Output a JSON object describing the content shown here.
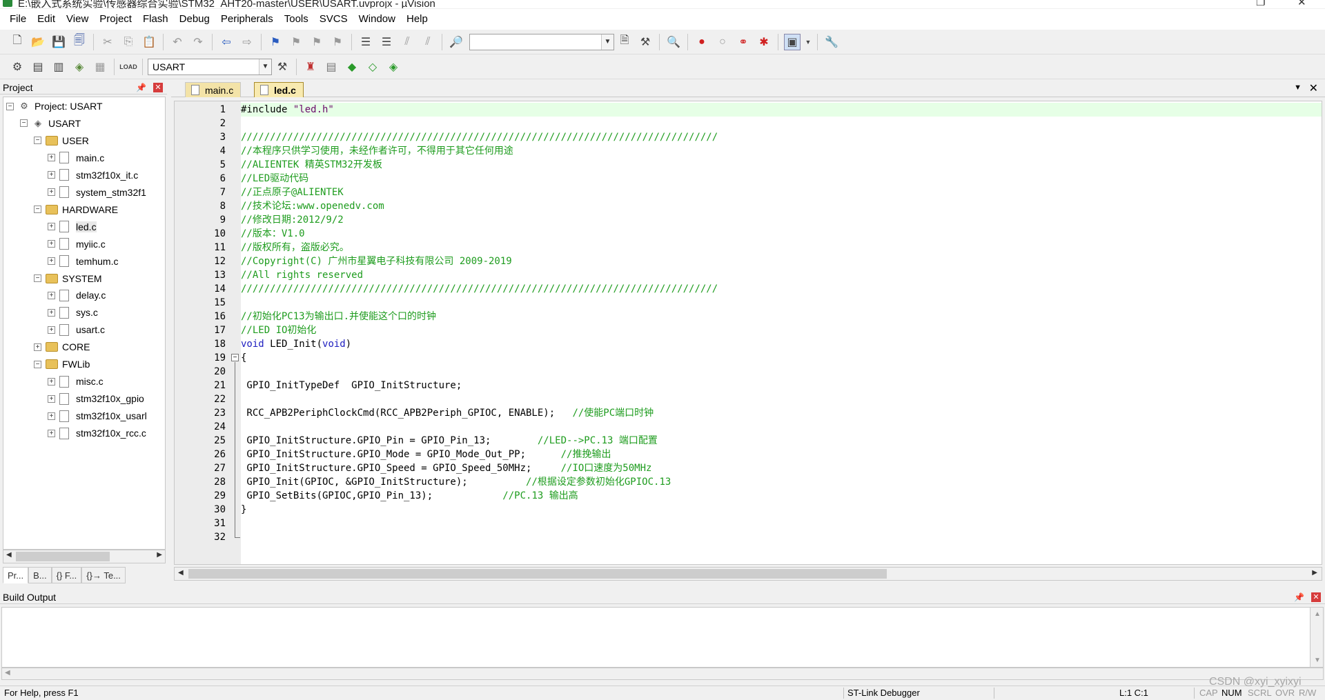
{
  "window": {
    "title": "E:\\嵌入式系统实验\\传感器综合实验\\STM32_AHT20-master\\USER\\USART.uvprojx - µVision"
  },
  "menu": [
    "File",
    "Edit",
    "View",
    "Project",
    "Flash",
    "Debug",
    "Peripherals",
    "Tools",
    "SVCS",
    "Window",
    "Help"
  ],
  "toolbar": {
    "target_value": "USART"
  },
  "project_panel": {
    "title": "Project",
    "tree": [
      {
        "label": "Project: USART",
        "level": 0,
        "kind": "project",
        "expanded": true
      },
      {
        "label": "USART",
        "level": 1,
        "kind": "target",
        "expanded": true
      },
      {
        "label": "USER",
        "level": 2,
        "kind": "folder",
        "expanded": true
      },
      {
        "label": "main.c",
        "level": 3,
        "kind": "file"
      },
      {
        "label": "stm32f10x_it.c",
        "level": 3,
        "kind": "file"
      },
      {
        "label": "system_stm32f1",
        "level": 3,
        "kind": "file"
      },
      {
        "label": "HARDWARE",
        "level": 2,
        "kind": "folder",
        "expanded": true
      },
      {
        "label": "led.c",
        "level": 3,
        "kind": "file",
        "selected": true
      },
      {
        "label": "myiic.c",
        "level": 3,
        "kind": "file"
      },
      {
        "label": "temhum.c",
        "level": 3,
        "kind": "file"
      },
      {
        "label": "SYSTEM",
        "level": 2,
        "kind": "folder",
        "expanded": true
      },
      {
        "label": "delay.c",
        "level": 3,
        "kind": "file"
      },
      {
        "label": "sys.c",
        "level": 3,
        "kind": "file"
      },
      {
        "label": "usart.c",
        "level": 3,
        "kind": "file"
      },
      {
        "label": "CORE",
        "level": 2,
        "kind": "folder",
        "expanded": false
      },
      {
        "label": "FWLib",
        "level": 2,
        "kind": "folder",
        "expanded": true
      },
      {
        "label": "misc.c",
        "level": 3,
        "kind": "file"
      },
      {
        "label": "stm32f10x_gpio",
        "level": 3,
        "kind": "file"
      },
      {
        "label": "stm32f10x_usarl",
        "level": 3,
        "kind": "file"
      },
      {
        "label": "stm32f10x_rcc.c",
        "level": 3,
        "kind": "file"
      }
    ],
    "bottom_tabs": [
      "Pr...",
      "B...",
      "{} F...",
      "{}→ Te..."
    ]
  },
  "editor": {
    "tabs": [
      {
        "label": "main.c",
        "active": false
      },
      {
        "label": "led.c",
        "active": true
      }
    ],
    "current_line": 1,
    "lines": [
      [
        [
          "pl",
          "#include "
        ],
        [
          "str",
          "\"led.h\""
        ]
      ],
      [],
      [
        [
          "cm",
          "//////////////////////////////////////////////////////////////////////////////////"
        ]
      ],
      [
        [
          "cm",
          "//本程序只供学习使用，未经作者许可，不得用于其它任何用途"
        ]
      ],
      [
        [
          "cm",
          "//ALIENTEK 精英STM32开发板"
        ]
      ],
      [
        [
          "cm",
          "//LED驱动代码"
        ]
      ],
      [
        [
          "cm",
          "//正点原子@ALIENTEK"
        ]
      ],
      [
        [
          "cm",
          "//技术论坛:www.openedv.com"
        ]
      ],
      [
        [
          "cm",
          "//修改日期:2012/9/2"
        ]
      ],
      [
        [
          "cm",
          "//版本：V1.0"
        ]
      ],
      [
        [
          "cm",
          "//版权所有，盗版必究。"
        ]
      ],
      [
        [
          "cm",
          "//Copyright(C) 广州市星翼电子科技有限公司 2009-2019"
        ]
      ],
      [
        [
          "cm",
          "//All rights reserved"
        ]
      ],
      [
        [
          "cm",
          "//////////////////////////////////////////////////////////////////////////////////"
        ]
      ],
      [],
      [
        [
          "cm",
          "//初始化PC13为输出口.并使能这个口的时钟"
        ]
      ],
      [
        [
          "cm",
          "//LED IO初始化"
        ]
      ],
      [
        [
          "kw",
          "void"
        ],
        [
          "pl",
          " LED_Init("
        ],
        [
          "kw",
          "void"
        ],
        [
          "pl",
          ")"
        ]
      ],
      [
        [
          "pl",
          "{"
        ]
      ],
      [],
      [
        [
          "pl",
          " GPIO_InitTypeDef  GPIO_InitStructure;"
        ]
      ],
      [],
      [
        [
          "pl",
          " RCC_APB2PeriphClockCmd(RCC_APB2Periph_GPIOC, ENABLE);   "
        ],
        [
          "cm",
          "//使能PC端口时钟"
        ]
      ],
      [],
      [
        [
          "pl",
          " GPIO_InitStructure.GPIO_Pin = GPIO_Pin_13;        "
        ],
        [
          "cm",
          "//LED-->PC.13 端口配置"
        ]
      ],
      [
        [
          "pl",
          " GPIO_InitStructure.GPIO_Mode = GPIO_Mode_Out_PP;      "
        ],
        [
          "cm",
          "//推挽输出"
        ]
      ],
      [
        [
          "pl",
          " GPIO_InitStructure.GPIO_Speed = GPIO_Speed_50MHz;     "
        ],
        [
          "cm",
          "//IO口速度为50MHz"
        ]
      ],
      [
        [
          "pl",
          " GPIO_Init(GPIOC, &GPIO_InitStructure);          "
        ],
        [
          "cm",
          "//根据设定参数初始化GPIOC.13"
        ]
      ],
      [
        [
          "pl",
          " GPIO_SetBits(GPIOC,GPIO_Pin_13);            "
        ],
        [
          "cm",
          "//PC.13 输出高"
        ]
      ],
      [
        [
          "pl",
          "}"
        ]
      ],
      [],
      []
    ]
  },
  "build_output": {
    "title": "Build Output"
  },
  "status_bar": {
    "help": "For Help, press F1",
    "debugger": "ST-Link Debugger",
    "position": "L:1 C:1",
    "cap": "CAP",
    "num": "NUM",
    "scrl": "SCRL",
    "ovr": "OVR",
    "rw": "R/W"
  },
  "watermark": "CSDN @xyi_xyixyi"
}
